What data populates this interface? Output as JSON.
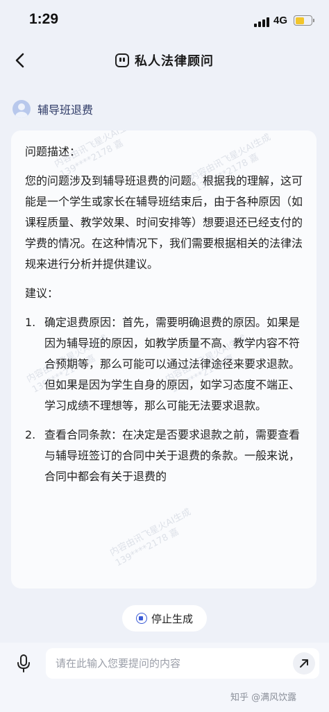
{
  "status_bar": {
    "time": "1:29",
    "network": "4G"
  },
  "header": {
    "title": "私人法律顾问"
  },
  "user_message": "辅导班退费",
  "answer": {
    "label1": "问题描述：",
    "paragraph": "您的问题涉及到辅导班退费的问题。根据我的理解，这可能是一个学生或家长在辅导班结束后，由于各种原因（如课程质量、教学效果、时间安排等）想要退还已经支付的学费的情况。在这种情况下，我们需要根据相关的法律法规来进行分析并提供建议。",
    "label2": "建议：",
    "items": [
      {
        "num": "1.",
        "text": "确定退费原因：首先，需要明确退费的原因。如果是因为辅导班的原因，如教学质量不高、教学内容不符合预期等，那么可能可以通过法律途径来要求退款。但如果是因为学生自身的原因，如学习态度不端正、学习成绩不理想等，那么可能无法要求退款。"
      },
      {
        "num": "2.",
        "text": "查看合同条款：在决定是否要求退款之前，需要查看与辅导班签订的合同中关于退费的条款。一般来说，合同中都会有关于退费的"
      }
    ]
  },
  "watermark": "内容由讯飞星火AI生成\n139****2178 嘉",
  "stop_button": "停止生成",
  "input": {
    "placeholder": "请在此输入您要提问的内容"
  },
  "source_watermark": "知乎 @满风饮露"
}
